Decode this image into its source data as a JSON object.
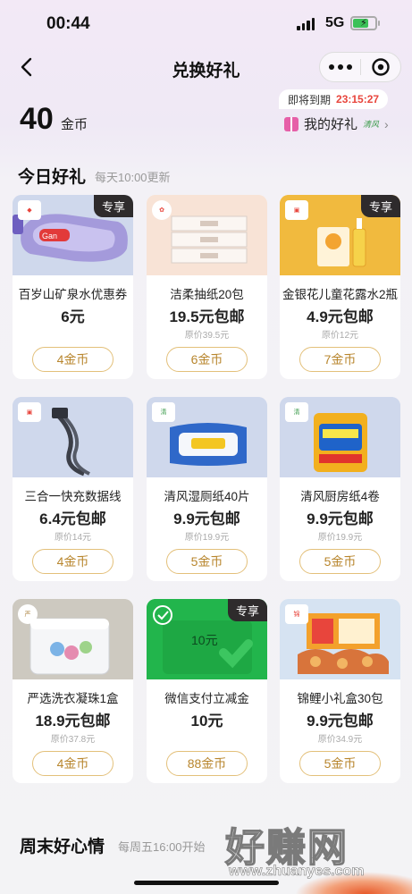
{
  "status_bar": {
    "time": "00:44",
    "network": "5G"
  },
  "nav": {
    "title": "兑换好礼"
  },
  "coins": {
    "amount": "40",
    "unit": "金币"
  },
  "expire": {
    "label": "即将到期",
    "countdown": "23:15:27"
  },
  "my_gifts": {
    "label": "我的好礼",
    "brand": "清风"
  },
  "today": {
    "title": "今日好礼",
    "subtitle": "每天10:00更新"
  },
  "products": [
    {
      "name": "百岁山矿泉水优惠券",
      "price": "6元",
      "original": "",
      "cost": "4金币",
      "exclusive": "专享",
      "bg": "#cfd8ec"
    },
    {
      "name": "洁柔抽纸20包",
      "price": "19.5元包邮",
      "original": "原价39.5元",
      "cost": "6金币",
      "exclusive": "",
      "bg": "#f8e3d6"
    },
    {
      "name": "金银花儿童花露水2瓶",
      "price": "4.9元包邮",
      "original": "原价12元",
      "cost": "7金币",
      "exclusive": "专享",
      "bg": "#f1ba3e"
    },
    {
      "name": "三合一快充数据线",
      "price": "6.4元包邮",
      "original": "原价14元",
      "cost": "4金币",
      "exclusive": "",
      "bg": "#cfd8ec"
    },
    {
      "name": "清风湿厕纸40片",
      "price": "9.9元包邮",
      "original": "原价19.9元",
      "cost": "5金币",
      "exclusive": "",
      "bg": "#cfd8ec"
    },
    {
      "name": "清风厨房纸4卷",
      "price": "9.9元包邮",
      "original": "原价19.9元",
      "cost": "5金币",
      "exclusive": "",
      "bg": "#cfd8ec"
    },
    {
      "name": "严选洗衣凝珠1盒",
      "price": "18.9元包邮",
      "original": "原价37.8元",
      "cost": "4金币",
      "exclusive": "",
      "bg": "#cdc9c0"
    },
    {
      "name": "微信支付立减金",
      "price": "10元",
      "original": "",
      "cost": "88金币",
      "exclusive": "专享",
      "bg": "#22b54c",
      "voucher": "10元"
    },
    {
      "name": "锦鲤小礼盒30包",
      "price": "9.9元包邮",
      "original": "原价34.9元",
      "cost": "5金币",
      "exclusive": "",
      "bg": "#d6e3f2"
    }
  ],
  "weekend": {
    "title": "周末好心情",
    "subtitle": "每周五16:00开始"
  },
  "watermark": {
    "text": "好赚网",
    "url": "www.zhuanyes.com"
  },
  "icons": [
    "back-arrow-icon",
    "more-dots-icon",
    "target-icon",
    "gift-icon",
    "chevron-right-icon"
  ]
}
